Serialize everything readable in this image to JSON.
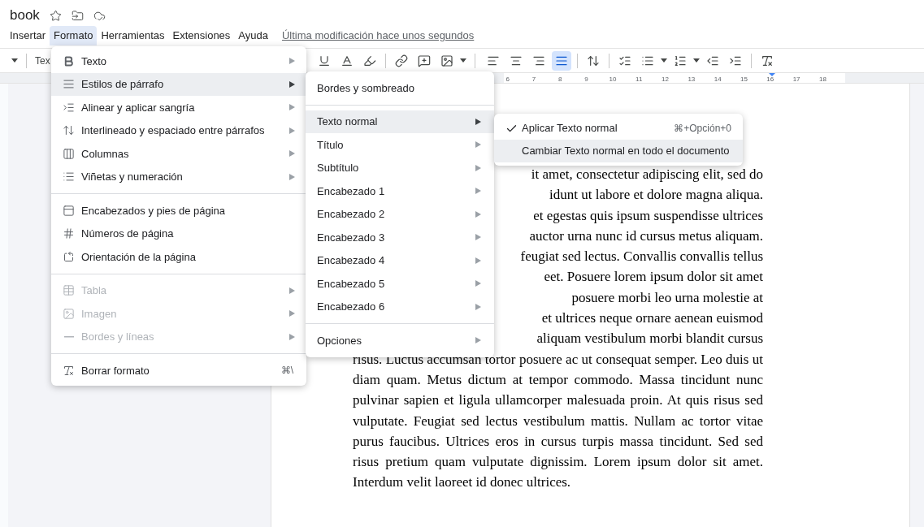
{
  "document_title": "book",
  "menu_bar": [
    {
      "label": "Insertar",
      "selected": false
    },
    {
      "label": "Formato",
      "selected": true
    },
    {
      "label": "Herramientas",
      "selected": false
    },
    {
      "label": "Extensiones",
      "selected": false
    },
    {
      "label": "Ayuda",
      "selected": false
    }
  ],
  "last_edit": "Última modificación hace unos segundos",
  "toolbar": {
    "style_label": "Tex",
    "align_buttons": [
      {
        "selected": false
      },
      {
        "selected": false
      },
      {
        "selected": false
      },
      {
        "selected": true
      }
    ]
  },
  "ruler": {
    "labels": [
      "6",
      "7",
      "8",
      "9",
      "10",
      "11",
      "12",
      "13",
      "14",
      "15",
      "16",
      "17",
      "18"
    ]
  },
  "format_menu": {
    "groups": [
      [
        {
          "label": "Texto",
          "submenu": true,
          "disabled": false,
          "selected": false
        },
        {
          "label": "Estilos de párrafo",
          "submenu": true,
          "disabled": false,
          "selected": true
        },
        {
          "label": "Alinear y aplicar sangría",
          "submenu": true,
          "disabled": false,
          "selected": false
        },
        {
          "label": "Interlineado y espaciado entre párrafos",
          "submenu": true,
          "disabled": false,
          "selected": false
        },
        {
          "label": "Columnas",
          "submenu": true,
          "disabled": false,
          "selected": false
        },
        {
          "label": "Viñetas y numeración",
          "submenu": true,
          "disabled": false,
          "selected": false
        }
      ],
      [
        {
          "label": "Encabezados y pies de página",
          "submenu": false,
          "disabled": false,
          "selected": false
        },
        {
          "label": "Números de página",
          "submenu": false,
          "disabled": false,
          "selected": false
        },
        {
          "label": "Orientación de la página",
          "submenu": false,
          "disabled": false,
          "selected": false
        }
      ],
      [
        {
          "label": "Tabla",
          "submenu": true,
          "disabled": true,
          "selected": false
        },
        {
          "label": "Imagen",
          "submenu": true,
          "disabled": true,
          "selected": false
        },
        {
          "label": "Bordes y líneas",
          "submenu": true,
          "disabled": true,
          "selected": false
        }
      ],
      [
        {
          "label": "Borrar formato",
          "submenu": false,
          "disabled": false,
          "selected": false,
          "shortcut": "⌘\\"
        }
      ]
    ]
  },
  "styles_menu": {
    "groups": [
      [
        {
          "label": "Bordes y sombreado",
          "submenu": false,
          "selected": false
        }
      ],
      [
        {
          "label": "Texto normal",
          "submenu": true,
          "selected": true
        },
        {
          "label": "Título",
          "submenu": true,
          "selected": false
        },
        {
          "label": "Subtítulo",
          "submenu": true,
          "selected": false
        },
        {
          "label": "Encabezado 1",
          "submenu": true,
          "selected": false
        },
        {
          "label": "Encabezado 2",
          "submenu": true,
          "selected": false
        },
        {
          "label": "Encabezado 3",
          "submenu": true,
          "selected": false
        },
        {
          "label": "Encabezado 4",
          "submenu": true,
          "selected": false
        },
        {
          "label": "Encabezado 5",
          "submenu": true,
          "selected": false
        },
        {
          "label": "Encabezado 6",
          "submenu": true,
          "selected": false
        }
      ],
      [
        {
          "label": "Opciones",
          "submenu": true,
          "selected": false
        }
      ]
    ]
  },
  "normal_text_menu": [
    {
      "label": "Aplicar Texto normal",
      "checked": true,
      "selected": false,
      "shortcut": "⌘+Opción+0"
    },
    {
      "label": "Cambiar Texto normal en todo el documento",
      "checked": false,
      "selected": true
    }
  ],
  "document": {
    "partial_lines": [
      "it amet, consectetur adipiscing elit, sed do",
      "idunt ut labore et dolore magna aliqua.",
      "et egestas quis ipsum suspendisse ultrices",
      "auctor urna nunc id cursus metus aliquam.",
      "feugiat sed lectus. Convallis convallis tellus",
      "eet. Posuere lorem ipsum dolor sit amet",
      "posuere morbi leo urna molestie at",
      "et ultrices neque ornare aenean euismod",
      "aliquam vestibulum morbi blandit cursus"
    ],
    "paragraph": "risus. Luctus accumsan tortor posuere ac ut consequat semper. Leo duis ut diam quam. Metus dictum at tempor commodo. Massa tincidunt nunc pulvinar sapien et ligula ullamcorper malesuada proin. At quis risus sed vulputate. Feugiat sed lectus vestibulum mattis. Nullam ac tortor vitae purus faucibus. Ultrices eros in cursus turpis massa tincidunt. Sed sed risus pretium quam vulputate dignissim. Lorem ipsum dolor sit amet. Interdum velit laoreet id donec ultrices."
  }
}
